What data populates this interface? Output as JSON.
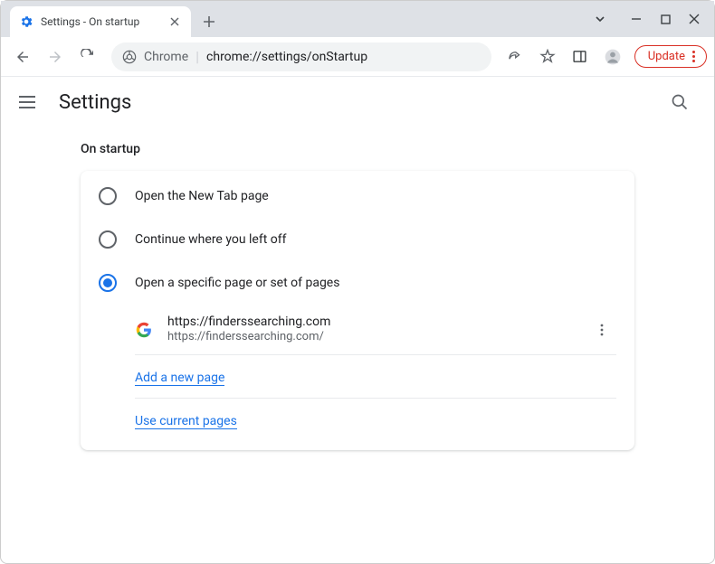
{
  "window": {
    "tab_title": "Settings - On startup",
    "update_label": "Update"
  },
  "address": {
    "prefix": "Chrome",
    "path": "chrome://settings/onStartup"
  },
  "header": {
    "title": "Settings"
  },
  "section": {
    "title": "On startup"
  },
  "options": {
    "new_tab": "Open the New Tab page",
    "continue": "Continue where you left off",
    "specific": "Open a specific page or set of pages"
  },
  "startup_page": {
    "title": "https://finderssearching.com",
    "url": "https://finderssearching.com/"
  },
  "links": {
    "add_page": "Add a new page",
    "use_current": "Use current pages"
  }
}
